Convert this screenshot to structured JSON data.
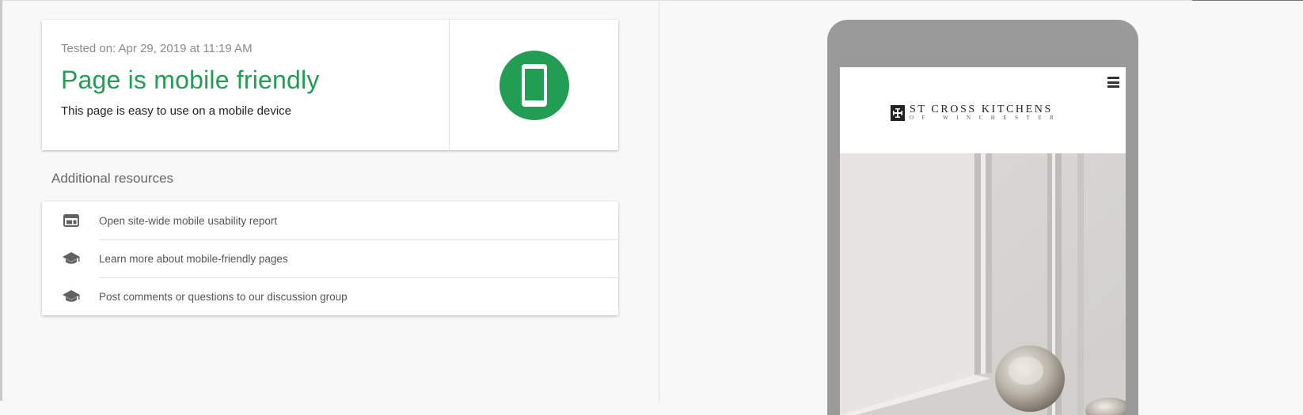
{
  "result": {
    "tested_on": "Tested on: Apr 29, 2019 at 11:19 AM",
    "headline": "Page is mobile friendly",
    "subline": "This page is easy to use on a mobile device",
    "icon": "smartphone-icon",
    "accent_color": "#219e54"
  },
  "resources": {
    "title": "Additional resources",
    "items": [
      {
        "label": "Open site-wide mobile usability report",
        "icon": "web-report-icon"
      },
      {
        "label": "Learn more about mobile-friendly pages",
        "icon": "school-cap-icon"
      },
      {
        "label": "Post comments or questions to our discussion group",
        "icon": "school-cap-icon"
      }
    ]
  },
  "preview": {
    "site_logo_main": "ST CROSS KITCHENS",
    "site_logo_sub": "OF WINCHESTER",
    "menu_icon": "hamburger-menu-icon"
  }
}
